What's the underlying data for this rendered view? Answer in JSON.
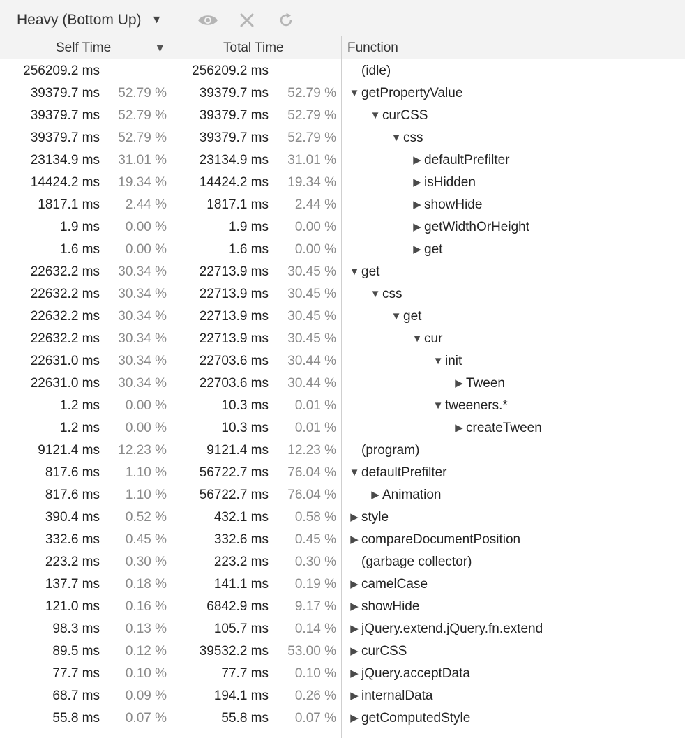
{
  "toolbar": {
    "view_label": "Heavy (Bottom Up)",
    "icons": [
      "chevron-down-icon",
      "eye-icon",
      "close-icon",
      "reload-icon"
    ]
  },
  "columns": {
    "self_time": "Self Time",
    "total_time": "Total Time",
    "function": "Function",
    "sort_indicator": "▼"
  },
  "rows": [
    {
      "self": "256209.2 ms",
      "self_pct": "",
      "total": "256209.2 ms",
      "total_pct": "",
      "depth": 0,
      "arrow": "none",
      "name": "(idle)"
    },
    {
      "self": "39379.7 ms",
      "self_pct": "52.79 %",
      "total": "39379.7 ms",
      "total_pct": "52.79 %",
      "depth": 0,
      "arrow": "expanded",
      "name": "getPropertyValue"
    },
    {
      "self": "39379.7 ms",
      "self_pct": "52.79 %",
      "total": "39379.7 ms",
      "total_pct": "52.79 %",
      "depth": 1,
      "arrow": "expanded",
      "name": "curCSS"
    },
    {
      "self": "39379.7 ms",
      "self_pct": "52.79 %",
      "total": "39379.7 ms",
      "total_pct": "52.79 %",
      "depth": 2,
      "arrow": "expanded",
      "name": "css"
    },
    {
      "self": "23134.9 ms",
      "self_pct": "31.01 %",
      "total": "23134.9 ms",
      "total_pct": "31.01 %",
      "depth": 3,
      "arrow": "collapsed",
      "name": "defaultPrefilter"
    },
    {
      "self": "14424.2 ms",
      "self_pct": "19.34 %",
      "total": "14424.2 ms",
      "total_pct": "19.34 %",
      "depth": 3,
      "arrow": "collapsed",
      "name": "isHidden"
    },
    {
      "self": "1817.1 ms",
      "self_pct": "2.44 %",
      "total": "1817.1 ms",
      "total_pct": "2.44 %",
      "depth": 3,
      "arrow": "collapsed",
      "name": "showHide"
    },
    {
      "self": "1.9 ms",
      "self_pct": "0.00 %",
      "total": "1.9 ms",
      "total_pct": "0.00 %",
      "depth": 3,
      "arrow": "collapsed",
      "name": "getWidthOrHeight"
    },
    {
      "self": "1.6 ms",
      "self_pct": "0.00 %",
      "total": "1.6 ms",
      "total_pct": "0.00 %",
      "depth": 3,
      "arrow": "collapsed",
      "name": "get"
    },
    {
      "self": "22632.2 ms",
      "self_pct": "30.34 %",
      "total": "22713.9 ms",
      "total_pct": "30.45 %",
      "depth": 0,
      "arrow": "expanded",
      "name": "get"
    },
    {
      "self": "22632.2 ms",
      "self_pct": "30.34 %",
      "total": "22713.9 ms",
      "total_pct": "30.45 %",
      "depth": 1,
      "arrow": "expanded",
      "name": "css"
    },
    {
      "self": "22632.2 ms",
      "self_pct": "30.34 %",
      "total": "22713.9 ms",
      "total_pct": "30.45 %",
      "depth": 2,
      "arrow": "expanded",
      "name": "get"
    },
    {
      "self": "22632.2 ms",
      "self_pct": "30.34 %",
      "total": "22713.9 ms",
      "total_pct": "30.45 %",
      "depth": 3,
      "arrow": "expanded",
      "name": "cur"
    },
    {
      "self": "22631.0 ms",
      "self_pct": "30.34 %",
      "total": "22703.6 ms",
      "total_pct": "30.44 %",
      "depth": 4,
      "arrow": "expanded",
      "name": "init"
    },
    {
      "self": "22631.0 ms",
      "self_pct": "30.34 %",
      "total": "22703.6 ms",
      "total_pct": "30.44 %",
      "depth": 5,
      "arrow": "collapsed",
      "name": "Tween"
    },
    {
      "self": "1.2 ms",
      "self_pct": "0.00 %",
      "total": "10.3 ms",
      "total_pct": "0.01 %",
      "depth": 4,
      "arrow": "expanded",
      "name": "tweeners.*"
    },
    {
      "self": "1.2 ms",
      "self_pct": "0.00 %",
      "total": "10.3 ms",
      "total_pct": "0.01 %",
      "depth": 5,
      "arrow": "collapsed",
      "name": "createTween"
    },
    {
      "self": "9121.4 ms",
      "self_pct": "12.23 %",
      "total": "9121.4 ms",
      "total_pct": "12.23 %",
      "depth": 0,
      "arrow": "none",
      "name": "(program)"
    },
    {
      "self": "817.6 ms",
      "self_pct": "1.10 %",
      "total": "56722.7 ms",
      "total_pct": "76.04 %",
      "depth": 0,
      "arrow": "expanded",
      "name": "defaultPrefilter"
    },
    {
      "self": "817.6 ms",
      "self_pct": "1.10 %",
      "total": "56722.7 ms",
      "total_pct": "76.04 %",
      "depth": 1,
      "arrow": "collapsed",
      "name": "Animation"
    },
    {
      "self": "390.4 ms",
      "self_pct": "0.52 %",
      "total": "432.1 ms",
      "total_pct": "0.58 %",
      "depth": 0,
      "arrow": "collapsed",
      "name": "style"
    },
    {
      "self": "332.6 ms",
      "self_pct": "0.45 %",
      "total": "332.6 ms",
      "total_pct": "0.45 %",
      "depth": 0,
      "arrow": "collapsed",
      "name": "compareDocumentPosition"
    },
    {
      "self": "223.2 ms",
      "self_pct": "0.30 %",
      "total": "223.2 ms",
      "total_pct": "0.30 %",
      "depth": 0,
      "arrow": "none",
      "name": "(garbage collector)"
    },
    {
      "self": "137.7 ms",
      "self_pct": "0.18 %",
      "total": "141.1 ms",
      "total_pct": "0.19 %",
      "depth": 0,
      "arrow": "collapsed",
      "name": "camelCase"
    },
    {
      "self": "121.0 ms",
      "self_pct": "0.16 %",
      "total": "6842.9 ms",
      "total_pct": "9.17 %",
      "depth": 0,
      "arrow": "collapsed",
      "name": "showHide"
    },
    {
      "self": "98.3 ms",
      "self_pct": "0.13 %",
      "total": "105.7 ms",
      "total_pct": "0.14 %",
      "depth": 0,
      "arrow": "collapsed",
      "name": "jQuery.extend.jQuery.fn.extend"
    },
    {
      "self": "89.5 ms",
      "self_pct": "0.12 %",
      "total": "39532.2 ms",
      "total_pct": "53.00 %",
      "depth": 0,
      "arrow": "collapsed",
      "name": "curCSS"
    },
    {
      "self": "77.7 ms",
      "self_pct": "0.10 %",
      "total": "77.7 ms",
      "total_pct": "0.10 %",
      "depth": 0,
      "arrow": "collapsed",
      "name": "jQuery.acceptData"
    },
    {
      "self": "68.7 ms",
      "self_pct": "0.09 %",
      "total": "194.1 ms",
      "total_pct": "0.26 %",
      "depth": 0,
      "arrow": "collapsed",
      "name": "internalData"
    },
    {
      "self": "55.8 ms",
      "self_pct": "0.07 %",
      "total": "55.8 ms",
      "total_pct": "0.07 %",
      "depth": 0,
      "arrow": "collapsed",
      "name": "getComputedStyle"
    }
  ]
}
